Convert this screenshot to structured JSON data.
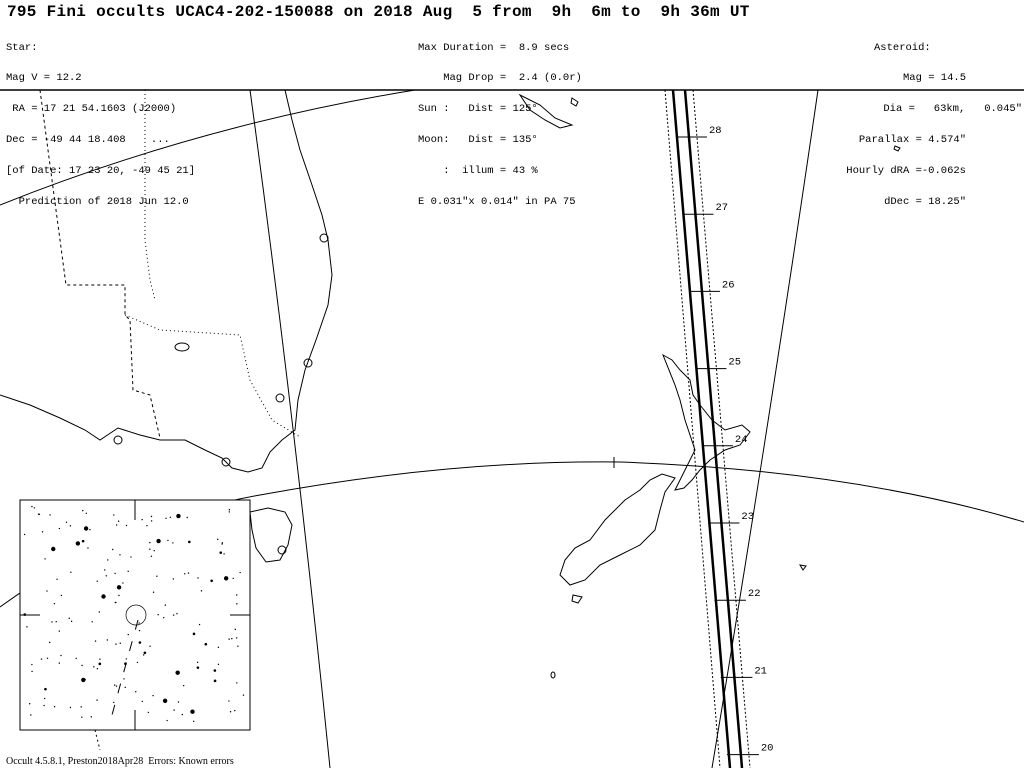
{
  "title": "795 Fini occults UCAC4-202-150088 on 2018 Aug  5 from  9h  6m to  9h 36m UT",
  "star": {
    "lines": [
      "Star:",
      "Mag V = 12.2",
      " RA = 17 21 54.1603 (J2000)",
      "Dec = -49 44 18.408    ...",
      "[of Date: 17 23 20, -49 45 21]",
      "  Prediction of 2018 Jun 12.0"
    ]
  },
  "event": {
    "lines": [
      "Max Duration =  8.9 secs",
      "    Mag Drop =  2.4 (0.0r)",
      "Sun :   Dist = 125°",
      "Moon:   Dist = 135°",
      "    :  illum = 43 %",
      "E 0.031\"x 0.014\" in PA 75"
    ]
  },
  "asteroid": {
    "lines": [
      "Asteroid:",
      "Mag = 14.5",
      "Dia =   63km,   0.045\"",
      "Parallax = 4.574\"",
      "Hourly dRA =-0.062s",
      "dDec = 18.25\""
    ]
  },
  "path_ticks": [
    "28",
    "27",
    "26",
    "25",
    "24",
    "23",
    "22",
    "21",
    "20"
  ],
  "footer": "Occult 4.5.8.1, Preston2018Apr28  Errors: Known errors"
}
